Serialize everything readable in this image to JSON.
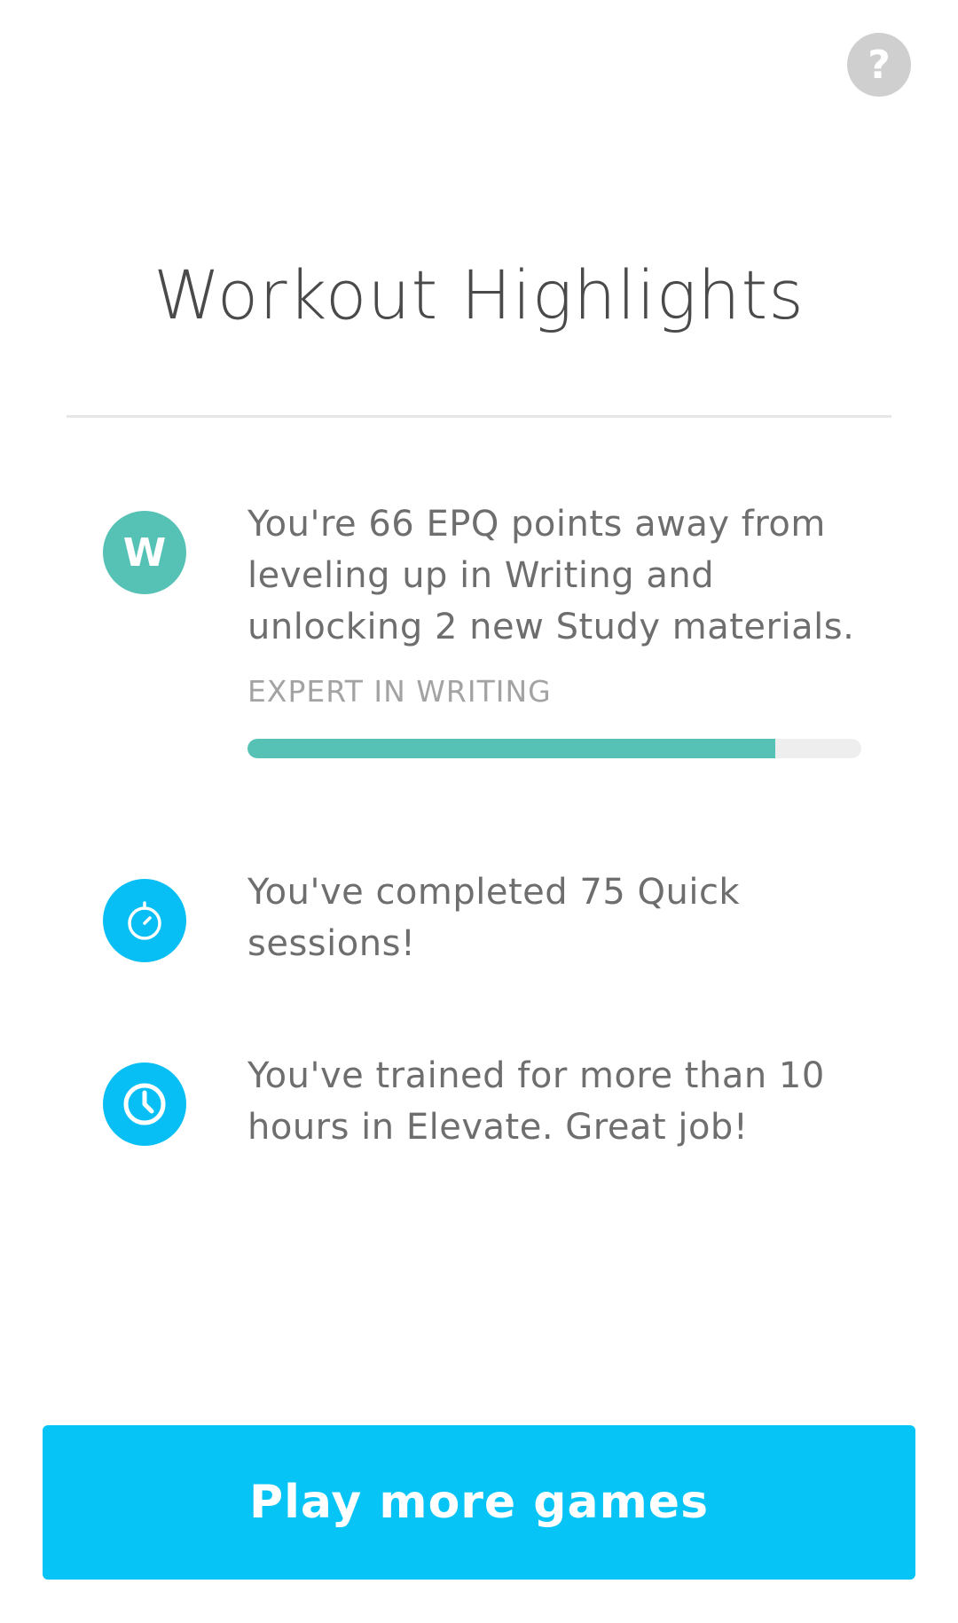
{
  "help": {
    "icon": "question-mark-icon",
    "label": "?"
  },
  "page": {
    "title": "Workout Highlights"
  },
  "highlights": [
    {
      "icon": "writing-badge-icon",
      "icon_letter": "W",
      "text": "You're 66 EPQ points away from leveling up in Writing and unlocking 2 new Study materials.",
      "progress_label": "EXPERT IN WRITING",
      "progress": 0.86
    },
    {
      "icon": "stopwatch-icon",
      "text": "You've completed 75 Quick sessions!"
    },
    {
      "icon": "clock-icon",
      "text": "You've trained for more than 10 hours in Elevate. Great job!"
    }
  ],
  "cta": {
    "label": "Play more games"
  },
  "colors": {
    "accent": "#07c4f6",
    "writing": "#56c2b5",
    "help": "#cfcfcf",
    "text": "#6e6e6e"
  }
}
